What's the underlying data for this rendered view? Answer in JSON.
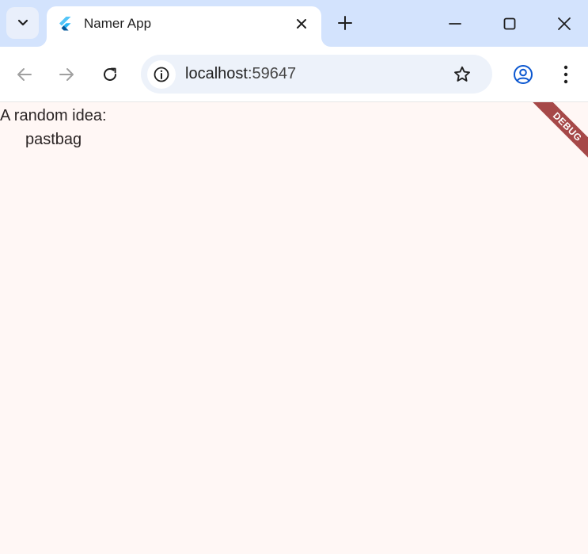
{
  "browser": {
    "tab": {
      "title": "Namer App"
    },
    "address": {
      "host": "localhost",
      "port": ":59647"
    }
  },
  "app": {
    "heading": "A random idea:",
    "idea": "pastbag",
    "debug_banner": "DEBUG"
  },
  "colors": {
    "tabstrip": "#d3e3fd",
    "omnibox": "#edf2fa",
    "page_background": "#fff7f5",
    "debug_banner": "#a64848",
    "profile_accent": "#0b57d0"
  },
  "icons": {
    "tab_search": "chevron-down-icon",
    "favicon": "flutter-logo",
    "tab_close": "close-icon",
    "new_tab": "plus-icon",
    "minimize": "minimize-icon",
    "maximize": "maximize-icon",
    "window_close": "close-icon",
    "back": "arrow-left-icon",
    "forward": "arrow-right-icon",
    "reload": "reload-icon",
    "site_info": "info-icon",
    "bookmark": "star-icon",
    "profile": "account-circle-icon",
    "menu": "kebab-icon"
  }
}
